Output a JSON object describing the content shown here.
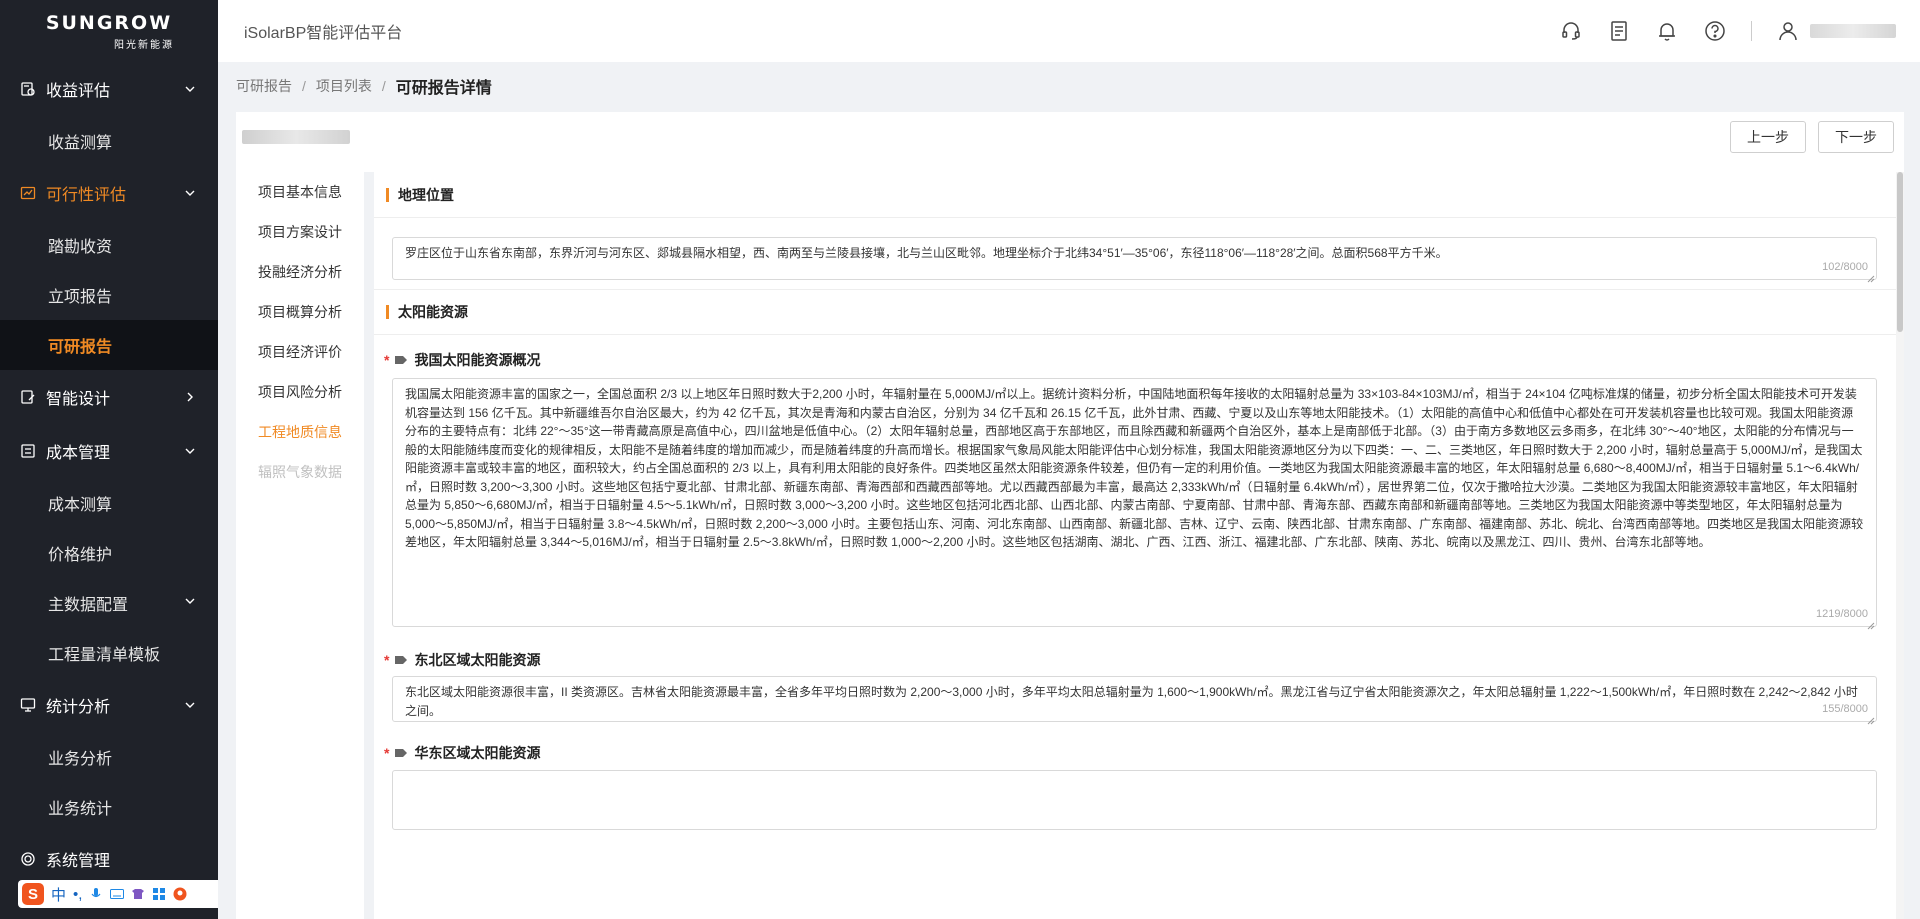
{
  "brand": {
    "name": "SUNGROW",
    "sub": "阳光新能源"
  },
  "app_title": "iSolarBP智能评估平台",
  "sidebar": {
    "groups": [
      {
        "label": "收益评估",
        "icon": "revenue-icon",
        "expanded": true,
        "items": [
          {
            "label": "收益测算"
          }
        ]
      },
      {
        "label": "可行性评估",
        "icon": "feasibility-icon",
        "expanded": true,
        "active": true,
        "items": [
          {
            "label": "踏勘收资"
          },
          {
            "label": "立项报告"
          },
          {
            "label": "可研报告",
            "selected": true
          }
        ]
      },
      {
        "label": "智能设计",
        "icon": "design-icon",
        "expanded": false,
        "items": []
      },
      {
        "label": "成本管理",
        "icon": "cost-icon",
        "expanded": true,
        "items": [
          {
            "label": "成本测算"
          },
          {
            "label": "价格维护"
          },
          {
            "label": "主数据配置",
            "has_arrow": true
          },
          {
            "label": "工程量清单模板"
          }
        ]
      },
      {
        "label": "统计分析",
        "icon": "stats-icon",
        "expanded": true,
        "items": [
          {
            "label": "业务分析"
          },
          {
            "label": "业务统计"
          }
        ]
      },
      {
        "label": "系统管理",
        "icon": "system-icon",
        "expanded": false,
        "items": []
      }
    ]
  },
  "ime": {
    "logo": "S",
    "lang": "中",
    "punct": "•,"
  },
  "header": {
    "icons": [
      "headset-icon",
      "document-icon",
      "bell-icon",
      "help-icon",
      "user-icon"
    ]
  },
  "breadcrumb": {
    "items": [
      "可研报告",
      "项目列表"
    ],
    "current": "可研报告详情"
  },
  "toolbar": {
    "prev_label": "上一步",
    "next_label": "下一步"
  },
  "steps": [
    {
      "label": "项目基本信息"
    },
    {
      "label": "项目方案设计"
    },
    {
      "label": "投融经济分析"
    },
    {
      "label": "项目概算分析"
    },
    {
      "label": "项目经济评价"
    },
    {
      "label": "项目风险分析"
    },
    {
      "label": "工程地质信息",
      "state": "active"
    },
    {
      "label": "辐照气象数据",
      "state": "disabled"
    }
  ],
  "sections": {
    "geo": {
      "title": "地理位置",
      "text": "罗庄区位于山东省东南部，东界沂河与河东区、郯城县隔水相望，西、南两至与兰陵县接壤，北与兰山区毗邻。地理坐标介于北纬34°51′—35°06′，东径118°06′—118°28′之间。总面积568平方千米。",
      "count": "102/8000"
    },
    "solar": {
      "title": "太阳能资源",
      "fields": [
        {
          "label": "我国太阳能资源概况",
          "required": true,
          "text": "我国属太阳能资源丰富的国家之一，全国总面积 2/3 以上地区年日照时数大于2,200 小时，年辐射量在 5,000MJ/㎡以上。据统计资料分析，中国陆地面积每年接收的太阳辐射总量为 33×103-84×103MJ/㎡，相当于 24×104 亿吨标准煤的储量，初步分析全国太阳能技术可开发装机容量达到 156 亿千瓦。其中新疆维吾尔自治区最大，约为 42 亿千瓦，其次是青海和内蒙古自治区，分别为 34 亿千瓦和 26.15 亿千瓦，此外甘肃、西藏、宁夏以及山东等地太阳能技术。（1）太阳能的高值中心和低值中心都处在可开发装机容量也比较可观。我国太阳能资源分布的主要特点有：北纬 22°～35°这一带青藏高原是高值中心，四川盆地是低值中心。（2）太阳年辐射总量，西部地区高于东部地区，而且除西藏和新疆两个自治区外，基本上是南部低于北部。（3）由于南方多数地区云多雨多，在北纬 30°～40°地区，太阳能的分布情况与一般的太阳能随纬度而变化的规律相反，太阳能不是随着纬度的增加而减少，而是随着纬度的升高而增长。根据国家气象局风能太阳能评估中心划分标准，我国太阳能资源地区分为以下四类：一、二、三类地区，年日照时数大于 2,200 小时，辐射总量高于 5,000MJ/㎡，是我国太阳能资源丰富或较丰富的地区，面积较大，约占全国总面积的 2/3 以上，具有利用太阳能的良好条件。四类地区虽然太阳能资源条件较差，但仍有一定的利用价值。一类地区为我国太阳能资源最丰富的地区，年太阳辐射总量 6,680～8,400MJ/㎡，相当于日辐射量 5.1～6.4kWh/㎡，日照时数 3,200～3,300 小时。这些地区包括宁夏北部、甘肃北部、新疆东南部、青海西部和西藏西部等地。尤以西藏西部最为丰富，最高达 2,333kWh/㎡（日辐射量 6.4kWh/㎡），居世界第二位，仅次于撒哈拉大沙漠。二类地区为我国太阳能资源较丰富地区，年太阳辐射总量为 5,850～6,680MJ/㎡，相当于日辐射量 4.5～5.1kWh/㎡，日照时数 3,000～3,200 小时。这些地区包括河北西北部、山西北部、内蒙古南部、宁夏南部、甘肃中部、青海东部、西藏东南部和新疆南部等地。三类地区为我国太阳能资源中等类型地区，年太阳辐射总量为 5,000～5,850MJ/㎡，相当于日辐射量 3.8～4.5kWh/㎡，日照时数 2,200～3,000 小时。主要包括山东、河南、河北东南部、山西南部、新疆北部、吉林、辽宁、云南、陕西北部、甘肃东南部、广东南部、福建南部、苏北、皖北、台湾西南部等地。四类地区是我国太阳能资源较差地区，年太阳辐射总量 3,344～5,016MJ/㎡，相当于日辐射量 2.5～3.8kWh/㎡，日照时数 1,000～2,200 小时。这些地区包括湖南、湖北、广西、江西、浙江、福建北部、广东北部、陕南、苏北、皖南以及黑龙江、四川、贵州、台湾东北部等地。",
          "count": "1219/8000"
        },
        {
          "label": "东北区域太阳能资源",
          "required": true,
          "text": "东北区域太阳能资源很丰富，II 类资源区。吉林省太阳能资源最丰富，全省多年平均日照时数为 2,200～3,000 小时，多年平均太阳总辐射量为 1,600～1,900kWh/㎡。黑龙江省与辽宁省太阳能资源次之，年太阳总辐射量 1,222～1,500kWh/㎡，年日照时数在 2,242～2,842 小时之间。",
          "count": "155/8000"
        },
        {
          "label": "华东区域太阳能资源",
          "required": true
        }
      ]
    }
  },
  "colors": {
    "accent": "#f08a24",
    "sidebar_bg": "#1f2229",
    "selected_bg": "#101217"
  }
}
